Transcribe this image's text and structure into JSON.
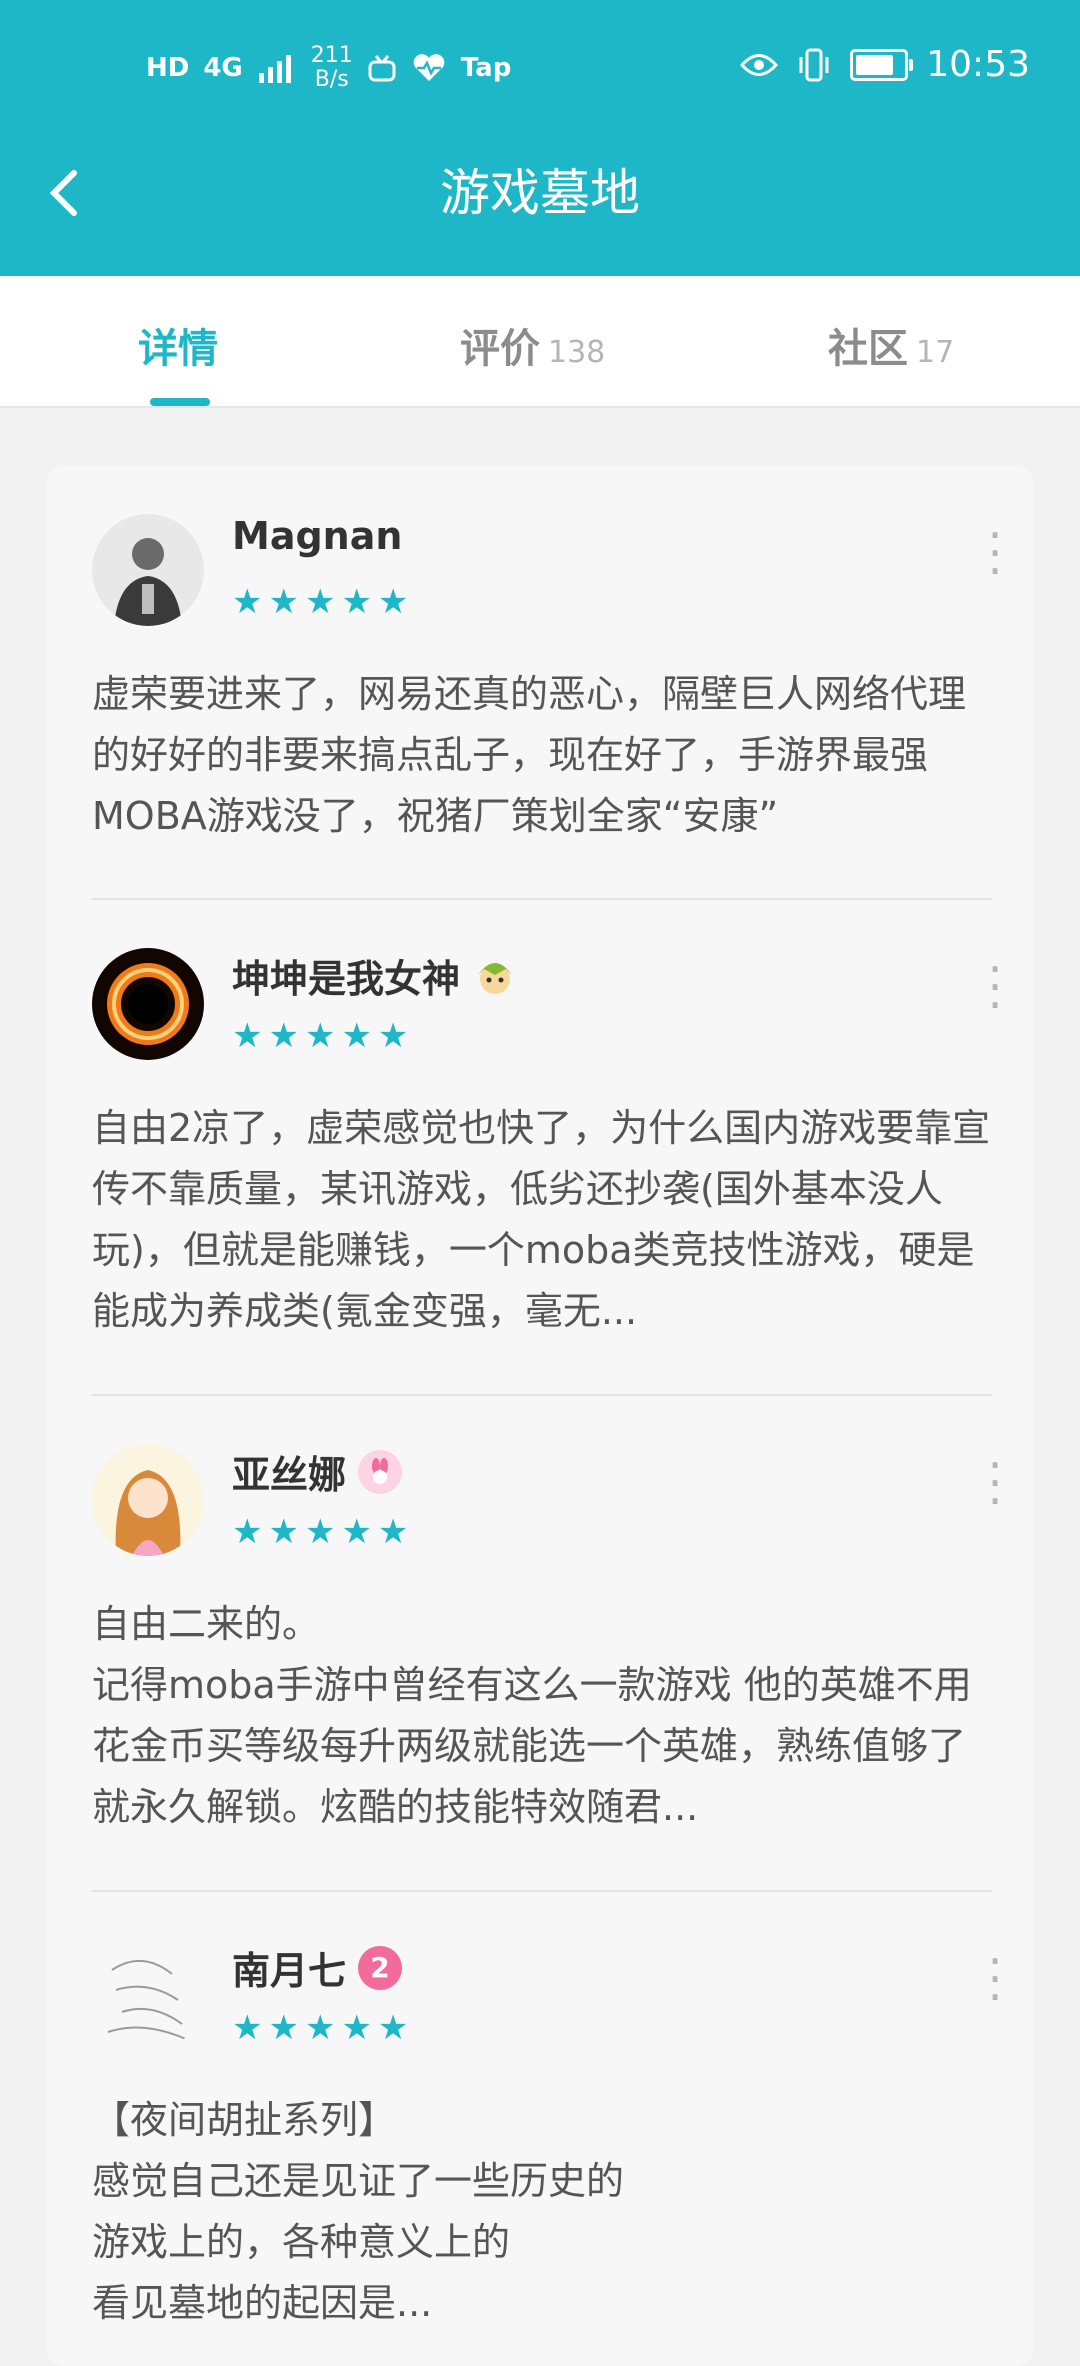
{
  "status_bar": {
    "icons_left": [
      "HD",
      "4G",
      "signal-icon"
    ],
    "net_speed_value": "211",
    "net_speed_unit": "B/s",
    "tap_label": "Tap",
    "time": "10:53",
    "battery_level": 0.8
  },
  "header": {
    "title": "游戏墓地",
    "back_icon": "chevron-left-icon"
  },
  "tabs": [
    {
      "label": "详情",
      "count": ""
    },
    {
      "label": "评价",
      "count": "138"
    },
    {
      "label": "社区",
      "count": "17"
    }
  ],
  "active_tab": 0,
  "accent_color": "#1db7c7",
  "reviews": [
    {
      "username": "Magnan",
      "rating": 5,
      "stars": "★★★★★",
      "text": "虚荣要进来了，网易还真的恶心，隔壁巨人网络代理的好好的非要来搞点乱子，现在好了，手游界最强MOBA游戏没了，祝猪厂策划全家“安康”"
    },
    {
      "username": "坤坤是我女神",
      "rating": 5,
      "stars": "★★★★★",
      "text": "自由2凉了，虚荣感觉也快了，为什么国内游戏要靠宣传不靠质量，某讯游戏，低劣还抄袭(国外基本没人玩)，但就是能赚钱，一个moba类竞技性游戏，硬是能成为养成类(氪金变强，毫无..."
    },
    {
      "username": "亚丝娜",
      "rating": 5,
      "stars": "★★★★★",
      "text": "自由二来的。\n记得moba手游中曾经有这么一款游戏 他的英雄不用花金币买等级每升两级就能选一个英雄，熟练值够了就永久解锁。炫酷的技能特效随君..."
    },
    {
      "username": "南月七",
      "badge_text": "2",
      "rating": 5,
      "stars": "★★★★★",
      "text": "【夜间胡扯系列】\n感觉自己还是见证了一些历史的\n游戏上的，各种意义上的\n看见墓地的起因是..."
    }
  ]
}
